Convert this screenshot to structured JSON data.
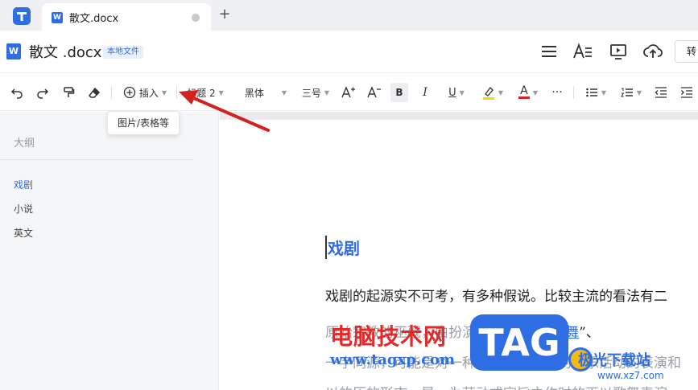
{
  "tab": {
    "title": "散文.docx"
  },
  "document": {
    "title": "散文 .docx",
    "badge": "本地文件"
  },
  "title_actions": {
    "convert_label": "转"
  },
  "toolbar": {
    "insert_label": "插入",
    "style_label": "标题 2",
    "font_label": "黑体",
    "size_label": "三号",
    "bold_label": "B",
    "italic_label": "I",
    "underline_label": "U",
    "more_label": "···",
    "font_color_label": "A",
    "tooltip": "图片/表格等",
    "highlight_color": "#f5d800",
    "font_color": "#e02020"
  },
  "sidebar": {
    "title": "大纲",
    "items": [
      {
        "label": "戏剧",
        "active": true
      },
      {
        "label": "小说",
        "active": false
      },
      {
        "label": "英文",
        "active": false
      }
    ]
  },
  "content": {
    "heading": "戏剧",
    "para1": "戏剧的起源实不可考，有多种假说。比较主流的看法有二",
    "para2_prefix": "原始宗教的巫觋，由扮演古代的",
    "para2_q1": "“",
    "para2_link1": "巫",
    "para2_mid": "”、“",
    "para2_link2": "舞",
    "para2_suffix": "”、",
    "para3": "一字同源，可能是对一种艺术戏剧胜利的欢乐活动的表演和",
    "para4": "以的历的形态，是一为萌动式宗旨之作时的巫以歌舞表演"
  },
  "watermark": {
    "text": "电脑技术网",
    "url": "www.tagxp.com",
    "tag": "TAG",
    "brand": "极光下载站",
    "site": "www.xz7.com"
  },
  "colors": {
    "accent": "#2f6ee2",
    "arrow": "#d62020"
  }
}
